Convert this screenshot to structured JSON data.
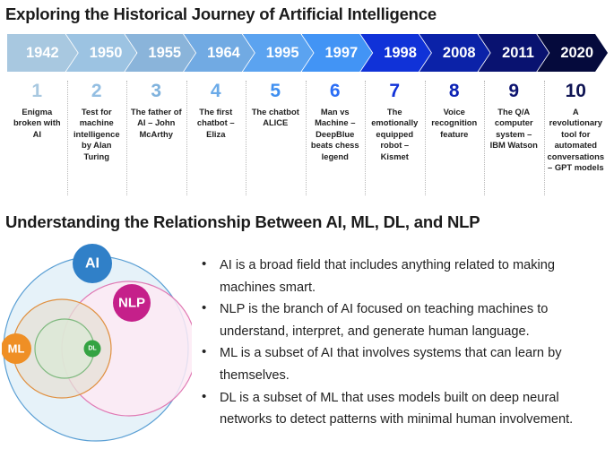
{
  "timeline": {
    "title": "Exploring the Historical Journey of Artificial Intelligence",
    "arrows": [
      {
        "year": "1942",
        "fill": "#a8c8e0"
      },
      {
        "year": "1950",
        "fill": "#9cc3e2"
      },
      {
        "year": "1955",
        "fill": "#8ab4da"
      },
      {
        "year": "1964",
        "fill": "#71aae3"
      },
      {
        "year": "1995",
        "fill": "#5ba3f0"
      },
      {
        "year": "1997",
        "fill": "#4294f5"
      },
      {
        "year": "1998",
        "fill": "#1032d8"
      },
      {
        "year": "2008",
        "fill": "#0b22a8"
      },
      {
        "year": "2011",
        "fill": "#091270"
      },
      {
        "year": "2020",
        "fill": "#050a3c"
      }
    ],
    "items": [
      {
        "num": "1",
        "desc": "Enigma broken with AI",
        "num_color": "#a8c8e0"
      },
      {
        "num": "2",
        "desc": "Test for machine intelligence by Alan Turing",
        "num_color": "#93bee2"
      },
      {
        "num": "3",
        "desc": "The father of AI – John McArthy",
        "num_color": "#7fb2dd"
      },
      {
        "num": "4",
        "desc": "The first chatbot – Eliza",
        "num_color": "#6aaae8"
      },
      {
        "num": "5",
        "desc": "The chatbot ALICE",
        "num_color": "#3f8ff0"
      },
      {
        "num": "6",
        "desc": "Man vs Machine – DeepBlue beats chess legend",
        "num_color": "#2b6ef5"
      },
      {
        "num": "7",
        "desc": "The emotionally equipped robot – Kismet",
        "num_color": "#1032d8"
      },
      {
        "num": "8",
        "desc": "Voice recognition feature",
        "num_color": "#0b22b4"
      },
      {
        "num": "9",
        "desc": "The Q/A computer system – IBM Watson",
        "num_color": "#0d1470"
      },
      {
        "num": "10",
        "desc": "A revolutionary tool for automated conversations – GPT models",
        "num_color": "#101554"
      }
    ]
  },
  "venn": {
    "title": "Understanding the Relationship Between AI, ML, DL, and NLP",
    "labels": {
      "ai": "AI",
      "ml": "ML",
      "dl": "DL",
      "nlp": "NLP"
    },
    "colors": {
      "ai_badge": "#3080c8",
      "ai_circle_stroke": "#5a9fd4",
      "ai_circle_fill": "#e3f1f8",
      "ml_badge": "#ef8f25",
      "ml_circle_stroke": "#e09040",
      "ml_circle_fill": "#e6e0d6",
      "dl_badge": "#34a343",
      "dl_circle_stroke": "#7fb97f",
      "dl_circle_fill": "#dce8d6",
      "nlp_badge": "#c5208a",
      "nlp_circle_stroke": "#e07ab4",
      "nlp_circle_fill": "#fdeaf4"
    },
    "bullets": [
      "AI is a broad field that includes anything related to making machines smart.",
      "NLP is the branch of AI focused on teaching machines to understand, interpret, and generate human language.",
      "ML is a subset of AI that involves systems that can learn by themselves.",
      "DL is a subset of ML that uses models built on deep neural networks to detect patterns with minimal human involvement."
    ]
  }
}
